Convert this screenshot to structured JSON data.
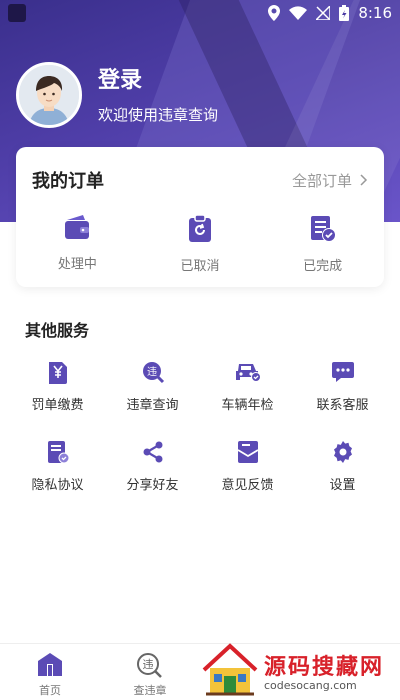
{
  "status_bar": {
    "time": "8:16"
  },
  "profile": {
    "title": "登录",
    "subtitle": "欢迎使用违章查询"
  },
  "orders": {
    "title": "我的订单",
    "all_label": "全部订单",
    "items": [
      {
        "label": "处理中",
        "icon": "wallet-icon"
      },
      {
        "label": "已取消",
        "icon": "clipboard-refresh-icon"
      },
      {
        "label": "已完成",
        "icon": "document-check-icon"
      }
    ]
  },
  "services": {
    "title": "其他服务",
    "items": [
      {
        "label": "罚单缴费",
        "icon": "ticket-yen-icon"
      },
      {
        "label": "违章查询",
        "icon": "violation-search-icon"
      },
      {
        "label": "车辆年检",
        "icon": "car-inspection-icon"
      },
      {
        "label": "联系客服",
        "icon": "chat-bubble-icon"
      },
      {
        "label": "隐私协议",
        "icon": "privacy-doc-icon"
      },
      {
        "label": "分享好友",
        "icon": "share-icon"
      },
      {
        "label": "意见反馈",
        "icon": "feedback-envelope-icon"
      },
      {
        "label": "设置",
        "icon": "gear-icon"
      }
    ]
  },
  "tabbar": {
    "items": [
      {
        "label": "首页",
        "icon": "home-icon"
      },
      {
        "label": "查违章",
        "icon": "search-violation-icon"
      }
    ]
  },
  "watermark": {
    "title": "源码搜藏网",
    "subtitle": "codesocang.com"
  },
  "colors": {
    "accent": "#5b4bb5",
    "header": "#4a3aa3",
    "watermark_red": "#d8212a"
  }
}
